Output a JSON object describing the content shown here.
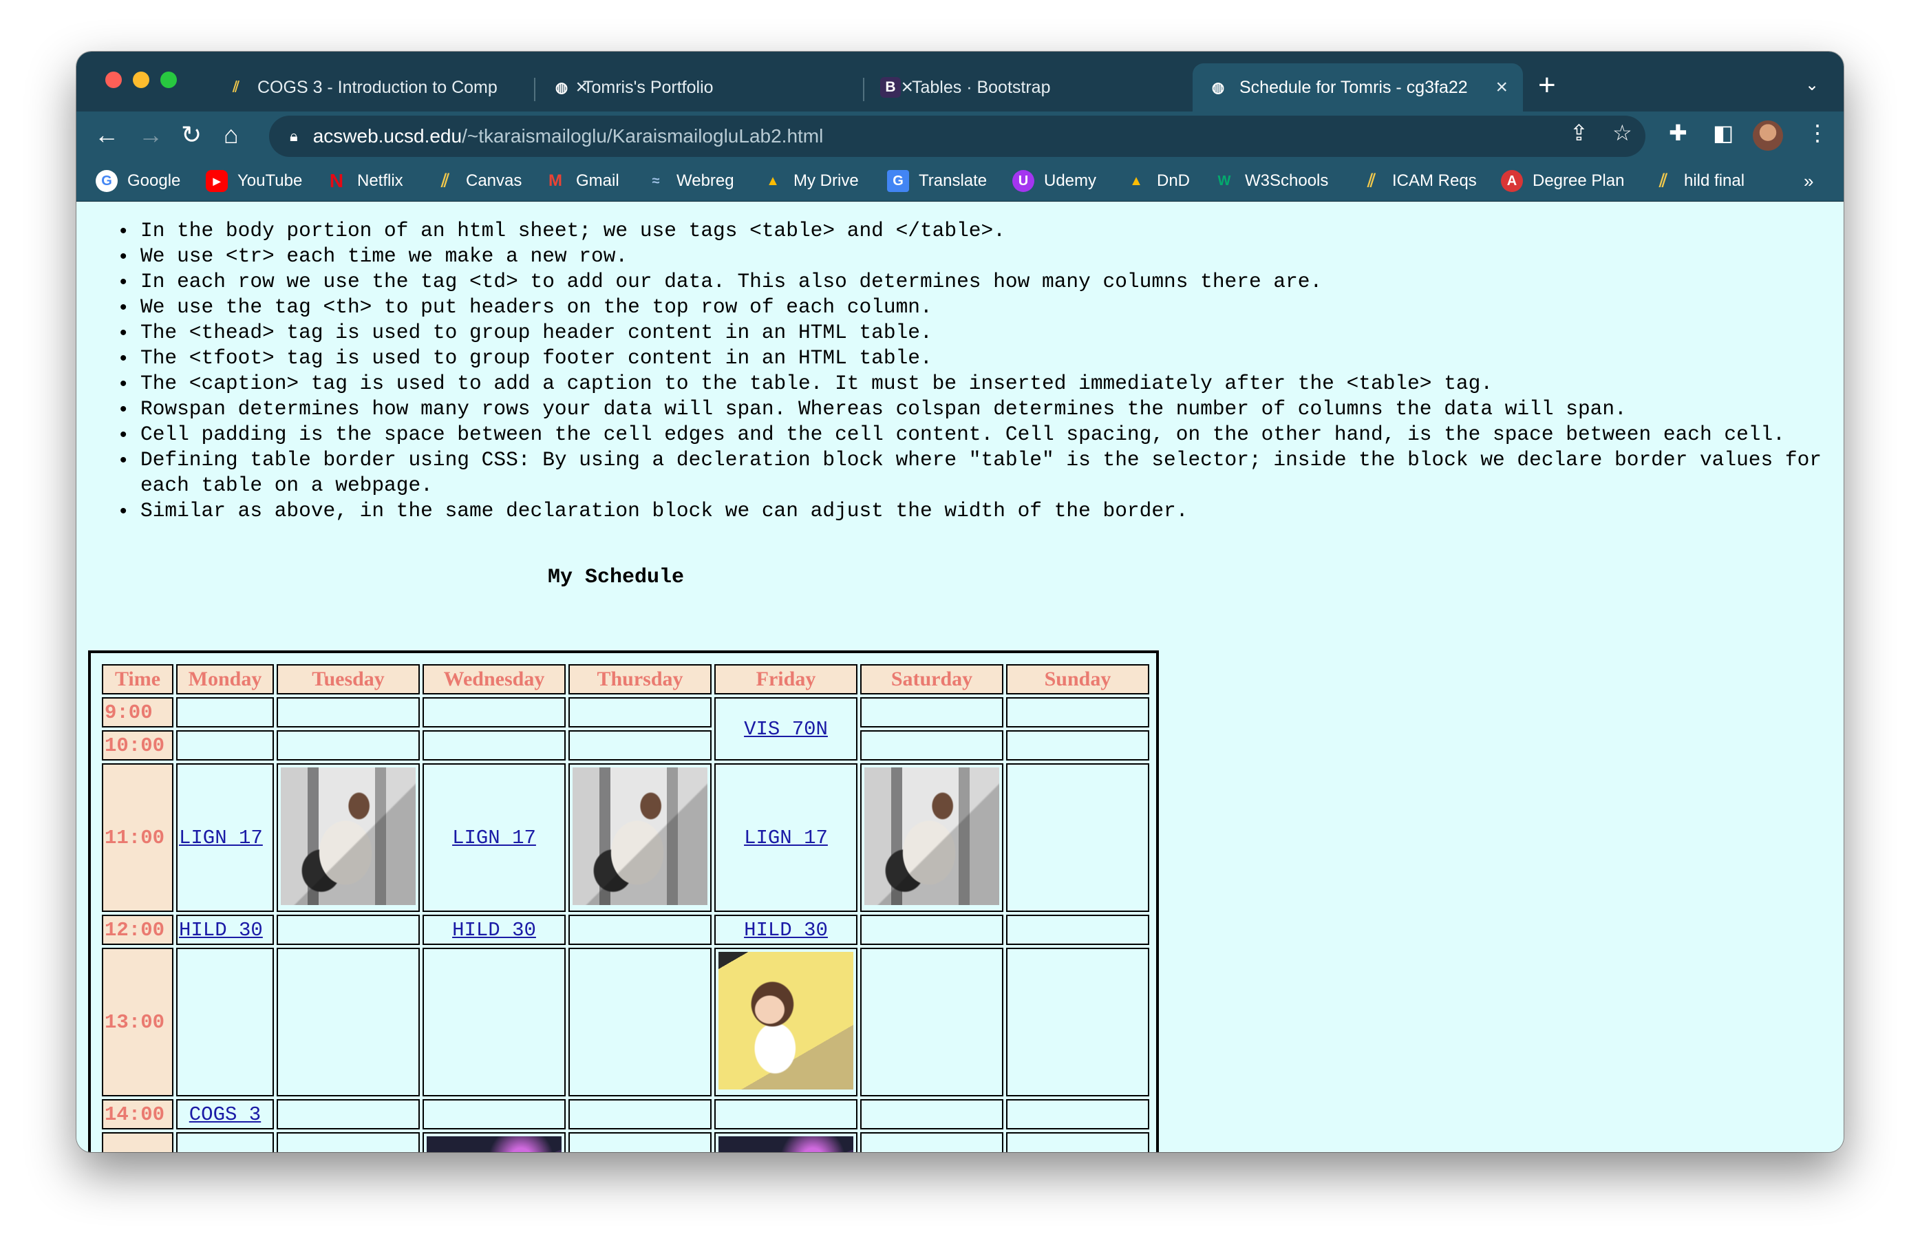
{
  "browser": {
    "tabs": [
      {
        "title": "COGS 3 - Introduction to Comp",
        "favicon": "canvas-icon",
        "active": false
      },
      {
        "title": "Tomris's Portfolio",
        "favicon": "globe-icon",
        "active": false
      },
      {
        "title": "Tables · Bootstrap",
        "favicon": "bootstrap-icon",
        "active": false
      },
      {
        "title": "Schedule for Tomris - cg3fa22",
        "favicon": "globe-icon",
        "active": true
      }
    ],
    "url_host": "acsweb.ucsd.edu",
    "url_path": "/~tkaraismailoglu/KaraismailogluLab2.html",
    "bookmarks": [
      "Google",
      "YouTube",
      "Netflix",
      "Canvas",
      "Gmail",
      "Webreg",
      "My Drive",
      "Translate",
      "Udemy",
      "DnD",
      "W3Schools",
      "ICAM Reqs",
      "Degree Plan",
      "hild final"
    ],
    "colors": {
      "chrome_dark": "#1b3d4f",
      "chrome_toolbar": "#23556b",
      "page_bg": "#e0fdfd"
    }
  },
  "notes": [
    "In the body portion of an html sheet; we use tags <table> and </table>.",
    "We use <tr> each time we make a new row.",
    "In each row we use the tag <td> to add our data. This also determines how many columns there are.",
    "We use the tag <th> to put headers on the top row of each column.",
    "The <thead> tag is used to group header content in an HTML table.",
    "The <tfoot> tag is used to group footer content in an HTML table.",
    "The <caption> tag is used to add a caption to the table. It must be inserted immediately after the <table> tag.",
    "Rowspan determines how many rows your data will span. Whereas colspan determines the number of columns the data will span.",
    "Cell padding is the space between the cell edges and the cell content. Cell spacing, on the other hand, is the space between each cell.",
    "Defining table border using CSS: By using a decleration block where \"table\" is the selector; inside the block we declare border values for each table on a webpage.",
    "Similar as above, in the same declaration block we can adjust the width of the border."
  ],
  "schedule": {
    "caption": "My Schedule",
    "headers": [
      "Time",
      "Monday",
      "Tuesday",
      "Wednesday",
      "Thursday",
      "Friday",
      "Saturday",
      "Sunday"
    ],
    "times": [
      "9:00",
      "10:00",
      "11:00",
      "12:00",
      "13:00",
      "14:00"
    ],
    "links": {
      "vis": "VIS 70N",
      "lign": "LIGN 17",
      "hild": "HILD 30",
      "cogs": "COGS 3"
    },
    "images": {
      "gym": "gym-workout-photo",
      "art": "digital-drawing-photo",
      "game": "game-controller-photo"
    }
  }
}
